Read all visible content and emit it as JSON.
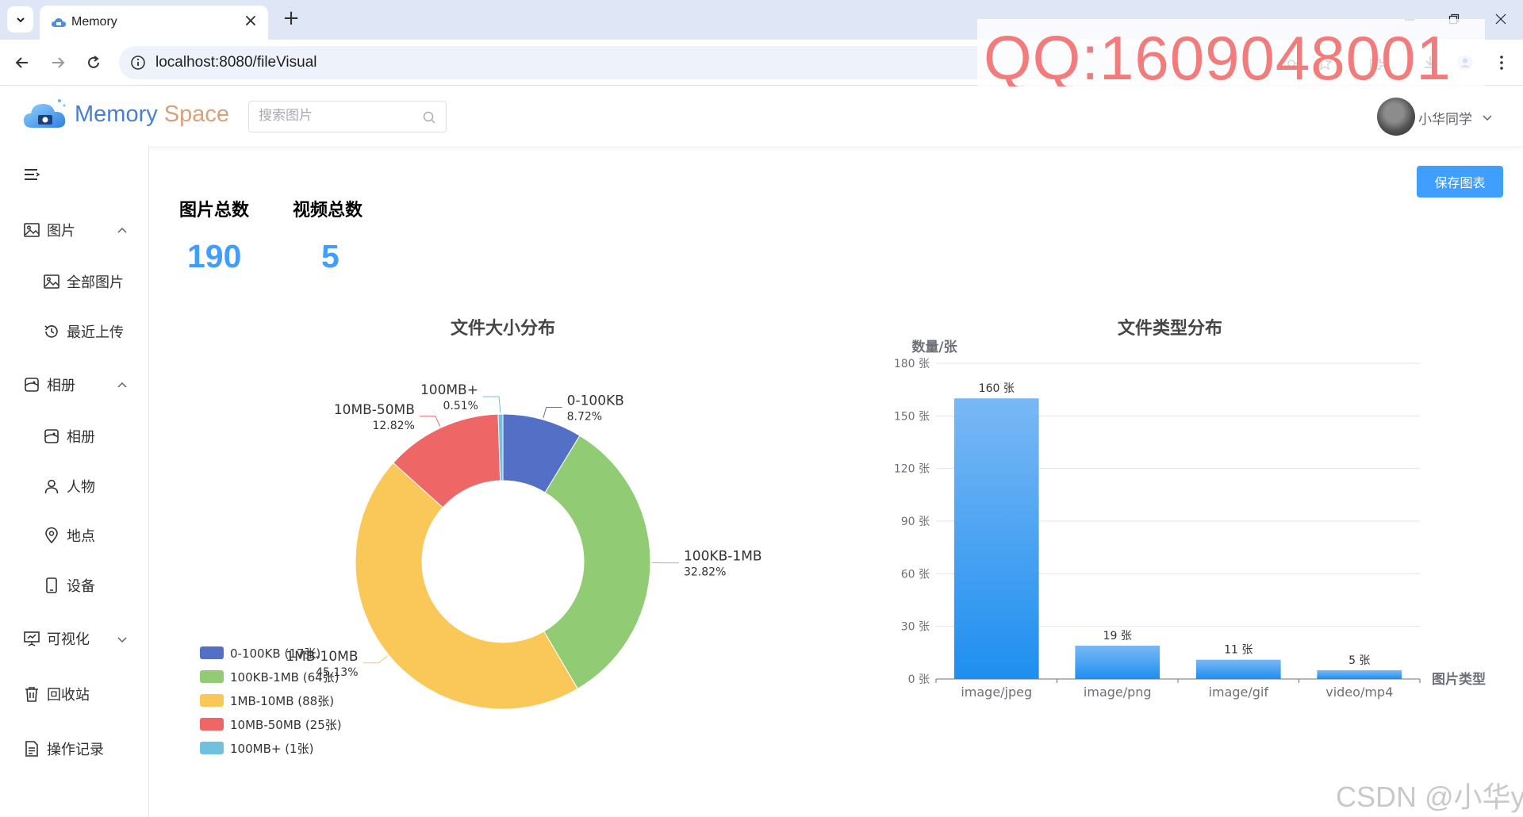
{
  "browser": {
    "tab_title": "Memory",
    "url": "localhost:8080/fileVisual"
  },
  "overlay": {
    "qq_watermark": "QQ:1609048001",
    "csdn_watermark": "CSDN @小华y"
  },
  "header": {
    "logo_word1": "Memory",
    "logo_word2": "Space",
    "search_placeholder": "搜索图片",
    "user_name": "小华同学"
  },
  "sidebar": {
    "items": [
      {
        "label": "图片",
        "icon": "image-icon",
        "expanded": true
      },
      {
        "label": "全部图片",
        "icon": "image-icon"
      },
      {
        "label": "最近上传",
        "icon": "history-icon"
      },
      {
        "label": "相册",
        "icon": "album-icon",
        "expanded": true
      },
      {
        "label": "相册",
        "icon": "album-icon"
      },
      {
        "label": "人物",
        "icon": "user-icon"
      },
      {
        "label": "地点",
        "icon": "location-icon"
      },
      {
        "label": "设备",
        "icon": "phone-icon"
      },
      {
        "label": "可视化",
        "icon": "chart-board-icon",
        "expanded": false
      },
      {
        "label": "回收站",
        "icon": "trash-icon"
      },
      {
        "label": "操作记录",
        "icon": "document-icon"
      }
    ]
  },
  "main": {
    "save_label": "保存图表",
    "stats": [
      {
        "label": "图片总数",
        "value": "190"
      },
      {
        "label": "视频总数",
        "value": "5"
      }
    ]
  },
  "chart_data": [
    {
      "type": "pie",
      "variant": "donut",
      "title": "文件大小分布",
      "legend_position": "bottom-left",
      "slices": [
        {
          "name": "0-100KB",
          "value": 17,
          "percent": "8.72%",
          "legend": "0-100KB (17张)",
          "color": "#5470c6"
        },
        {
          "name": "100KB-1MB",
          "value": 64,
          "percent": "32.82%",
          "legend": "100KB-1MB (64张)",
          "color": "#91cc75"
        },
        {
          "name": "1MB-10MB",
          "value": 88,
          "percent": "45.13%",
          "legend": "1MB-10MB (88张)",
          "color": "#fac858"
        },
        {
          "name": "10MB-50MB",
          "value": 25,
          "percent": "12.82%",
          "legend": "10MB-50MB (25张)",
          "color": "#ee6666"
        },
        {
          "name": "100MB+",
          "value": 1,
          "percent": "0.51%",
          "legend": "100MB+ (1张)",
          "color": "#73c0de"
        }
      ]
    },
    {
      "type": "bar",
      "title": "文件类型分布",
      "ylabel": "数量/张",
      "xlabel": "图片类型",
      "categories": [
        "image/jpeg",
        "image/png",
        "image/gif",
        "video/mp4"
      ],
      "values": [
        160,
        19,
        11,
        5
      ],
      "value_labels": [
        "160 张",
        "19 张",
        "11 张",
        "5 张"
      ],
      "ylim": [
        0,
        180
      ],
      "yticks": [
        0,
        30,
        60,
        90,
        120,
        150,
        180
      ],
      "ytick_labels": [
        "0 张",
        "30 张",
        "60 张",
        "90 张",
        "120 张",
        "150 张",
        "180 张"
      ],
      "grid": true,
      "bar_color_top": "#7ab8f5",
      "bar_color_bottom": "#1e8fef"
    }
  ]
}
